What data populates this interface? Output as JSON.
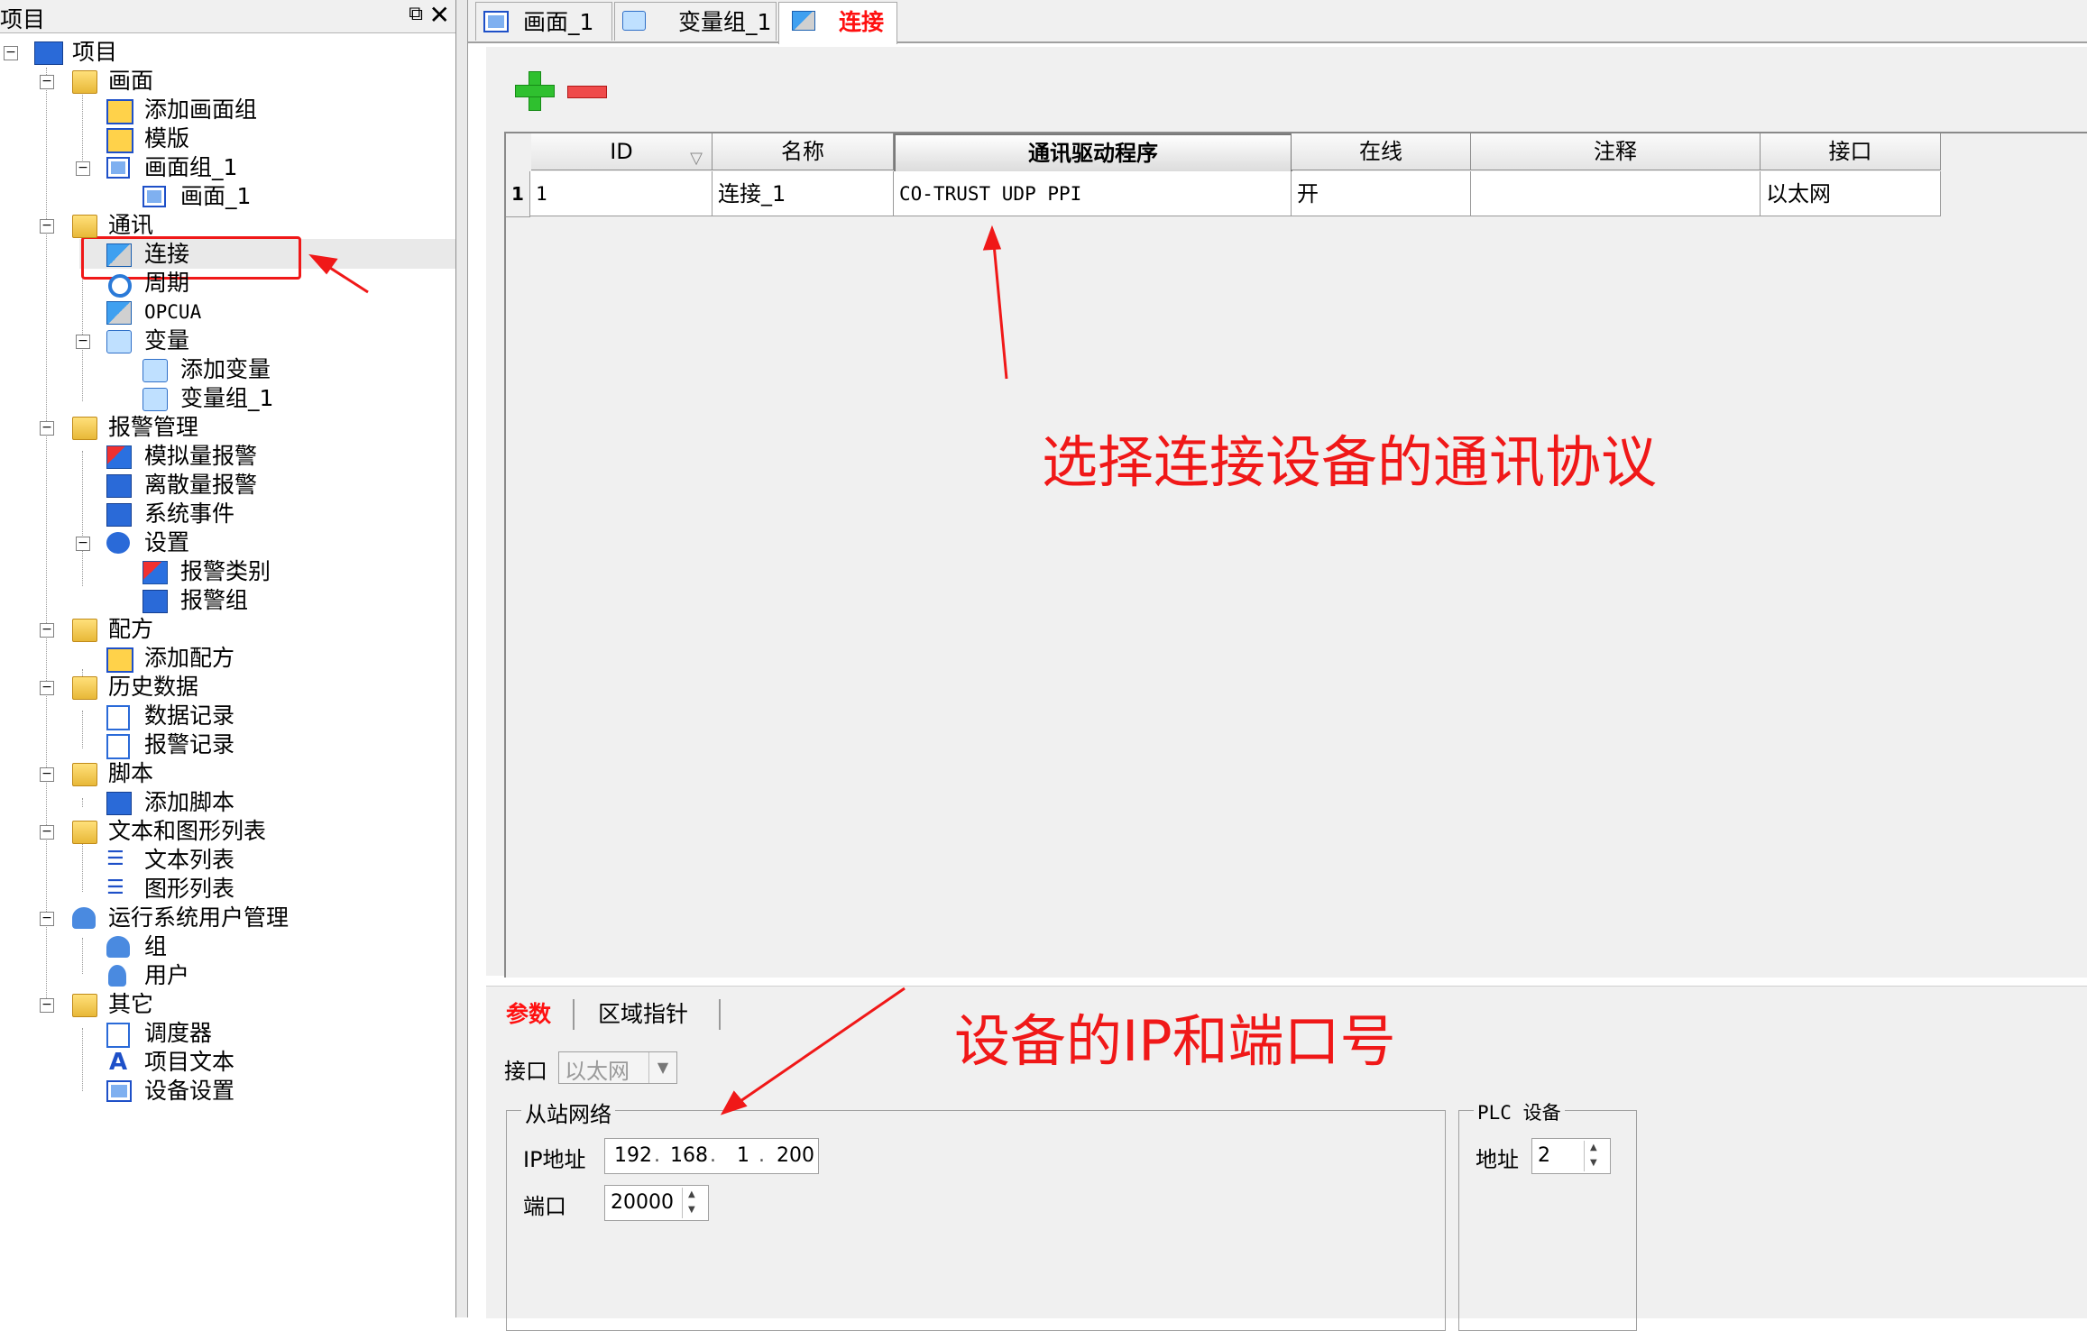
{
  "project_panel": {
    "title": "项目",
    "pin_icon": "pin-icon",
    "close_icon": "close-icon"
  },
  "tree": {
    "root": "项目",
    "screens": "画面",
    "add_screen_group": "添加画面组",
    "template": "模版",
    "screen_group": "画面组_1",
    "screen_1": "画面_1",
    "comms": "通讯",
    "connections": "连接",
    "cycles": "周期",
    "opcua": "OPCUA",
    "variables": "变量",
    "add_variable": "添加变量",
    "variable_group": "变量组_1",
    "alarm_mgmt": "报警管理",
    "analog_alarm": "模拟量报警",
    "discrete_alarm": "离散量报警",
    "system_events": "系统事件",
    "settings": "设置",
    "alarm_class": "报警类别",
    "alarm_group": "报警组",
    "recipes": "配方",
    "add_recipe": "添加配方",
    "history": "历史数据",
    "data_log": "数据记录",
    "alarm_log": "报警记录",
    "scripts": "脚本",
    "add_script": "添加脚本",
    "text_graphic_lists": "文本和图形列表",
    "text_list": "文本列表",
    "graphic_list": "图形列表",
    "runtime_users": "运行系统用户管理",
    "groups": "组",
    "users": "用户",
    "other": "其它",
    "scheduler": "调度器",
    "project_text": "项目文本",
    "device_settings": "设备设置"
  },
  "tabs": [
    {
      "label": "画面_1",
      "icon": "screen-icon"
    },
    {
      "label": "变量组_1",
      "icon": "variable-icon"
    },
    {
      "label": "连接",
      "icon": "connection-icon",
      "active": true
    }
  ],
  "toolbar": {
    "add_icon": "add-plus-icon",
    "remove_icon": "remove-minus-icon"
  },
  "grid": {
    "columns": [
      "ID",
      "名称",
      "通讯驱动程序",
      "在线",
      "注释",
      "接口"
    ],
    "sorted_column_glyph": "▽",
    "rows": [
      {
        "row_no": "1",
        "id": "1",
        "name": "连接_1",
        "driver": "CO-TRUST UDP PPI",
        "online": "开",
        "comment": "",
        "interface": "以太网"
      }
    ]
  },
  "props": {
    "tab_params": "参数",
    "tab_area_pointer": "区域指针",
    "interface_label": "接口",
    "interface_value": "以太网",
    "slave_network_title": "从站网络",
    "ip_label": "IP地址",
    "ip": [
      "192",
      "168",
      "1",
      "200"
    ],
    "port_label": "端口",
    "port_value": "20000",
    "plc_title": "PLC 设备",
    "address_label": "地址",
    "address_value": "2"
  },
  "annotations": {
    "protocol_note": "选择连接设备的通讯协议",
    "ip_port_note": "设备的IP和端口号",
    "color": "#f01818"
  }
}
